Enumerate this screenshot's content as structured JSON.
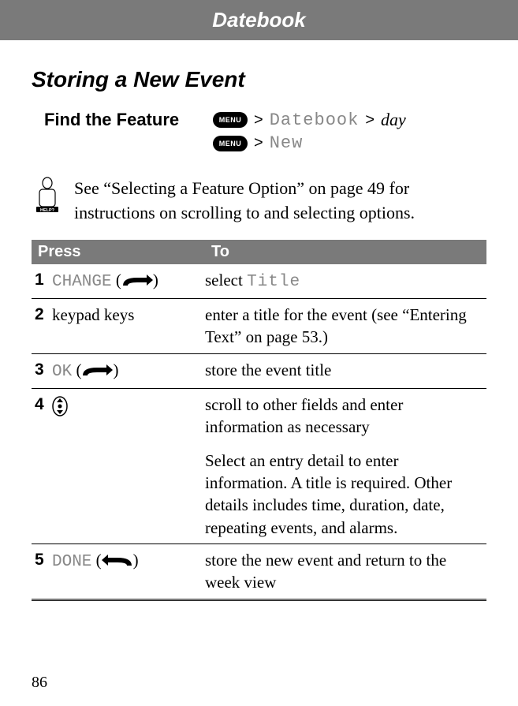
{
  "header": "Datebook",
  "section_title": "Storing a New Event",
  "find_feature_label": "Find the Feature",
  "menu_label": "MENU",
  "path1": {
    "a": "Datebook",
    "b": "day"
  },
  "path2": {
    "a": "New"
  },
  "help_text": "See “Selecting a Feature Option” on page 49 for instructions on scrolling to and selecting options.",
  "help_icon_label": "HELP?",
  "table_head": {
    "press": "Press",
    "to": "To"
  },
  "rows": [
    {
      "num": "1",
      "press_label": "CHANGE",
      "press_plain": "",
      "icon": "right",
      "to_a": "select ",
      "to_code": "Title",
      "to_b": ""
    },
    {
      "num": "2",
      "press_label": "",
      "press_plain": "keypad keys",
      "icon": "",
      "to_a": "enter a title for the event (see “Entering Text” on page 53.)",
      "to_code": "",
      "to_b": ""
    },
    {
      "num": "3",
      "press_label": "OK",
      "press_plain": "",
      "icon": "right",
      "to_a": "store the event title",
      "to_code": "",
      "to_b": ""
    },
    {
      "num": "4",
      "press_label": "",
      "press_plain": "",
      "icon": "scroll",
      "to_a": "scroll to other fields and enter information as necessary",
      "to_code": "",
      "to_b": "Select an entry detail to enter information. A title is required. Other details includes time, duration, date, repeating events, and alarms."
    },
    {
      "num": "5",
      "press_label": "DONE",
      "press_plain": "",
      "icon": "left",
      "to_a": "store the new event and return to the week view",
      "to_code": "",
      "to_b": ""
    }
  ],
  "page_number": "86",
  "gt": ">"
}
